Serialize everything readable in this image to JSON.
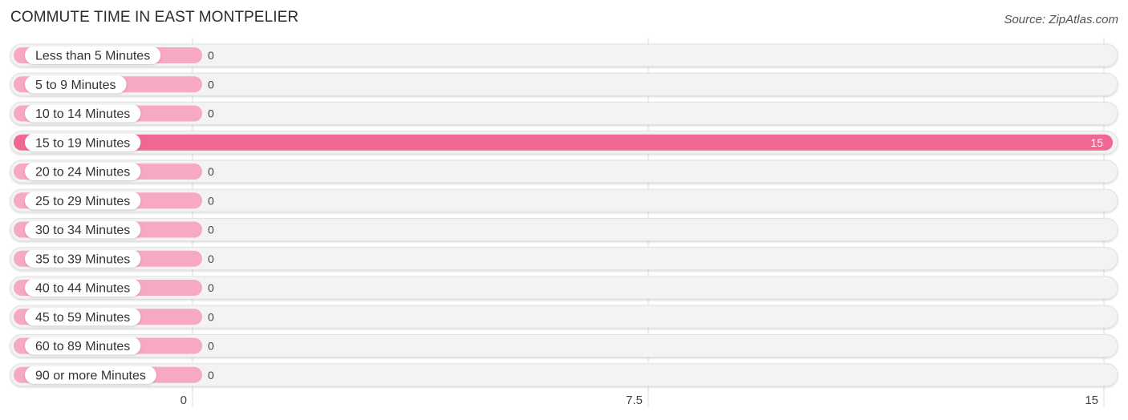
{
  "header": {
    "title": "COMMUTE TIME IN EAST MONTPELIER",
    "source": "Source: ZipAtlas.com"
  },
  "colors": {
    "bar_normal": "#f7a8c2",
    "bar_highlight": "#f06892",
    "track": "#f3f3f3",
    "grid": "#dddddd"
  },
  "chart_data": {
    "type": "bar",
    "orientation": "horizontal",
    "title": "COMMUTE TIME IN EAST MONTPELIER",
    "xlabel": "",
    "ylabel": "",
    "categories": [
      "Less than 5 Minutes",
      "5 to 9 Minutes",
      "10 to 14 Minutes",
      "15 to 19 Minutes",
      "20 to 24 Minutes",
      "25 to 29 Minutes",
      "30 to 34 Minutes",
      "35 to 39 Minutes",
      "40 to 44 Minutes",
      "45 to 59 Minutes",
      "60 to 89 Minutes",
      "90 or more Minutes"
    ],
    "values": [
      0,
      0,
      0,
      15,
      0,
      0,
      0,
      0,
      0,
      0,
      0,
      0
    ],
    "value_labels": [
      "0",
      "0",
      "0",
      "15",
      "0",
      "0",
      "0",
      "0",
      "0",
      "0",
      "0",
      "0"
    ],
    "highlight_index": 3,
    "xlim": [
      0,
      15
    ],
    "xticks": [
      0,
      7.5,
      15
    ],
    "xtick_labels": [
      "0",
      "7.5",
      "15"
    ],
    "grid": true,
    "legend": "none"
  }
}
